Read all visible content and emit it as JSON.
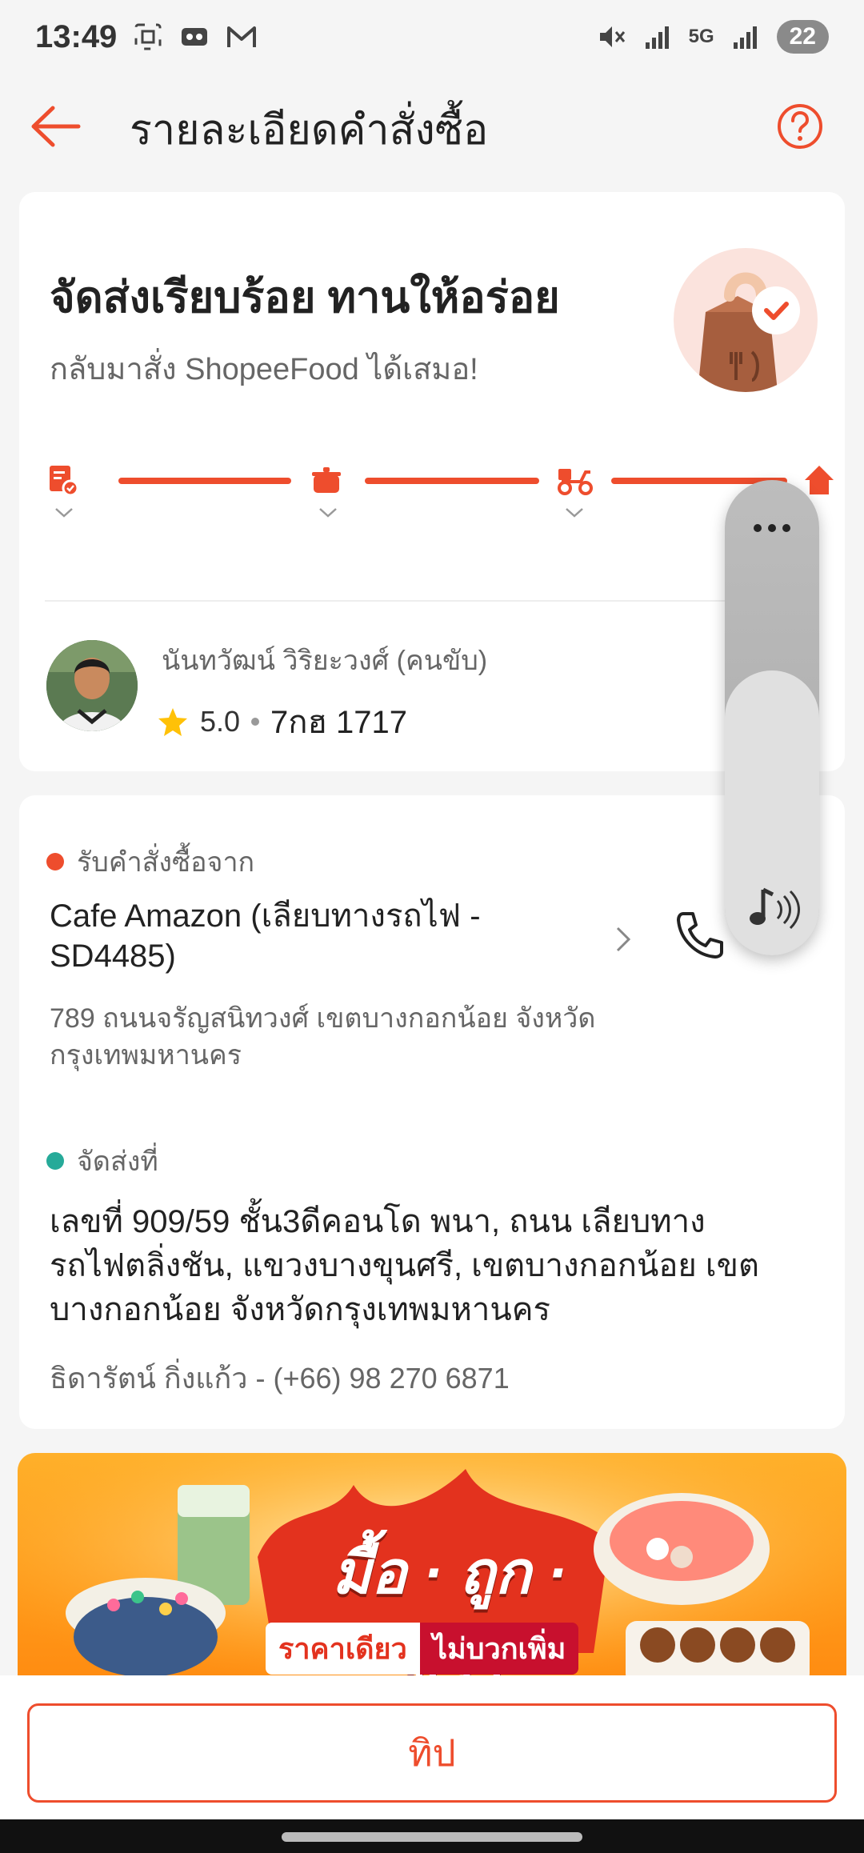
{
  "status_bar": {
    "time": "13:49",
    "network": "5G",
    "battery": "22"
  },
  "header": {
    "title": "รายละเอียดคำสั่งซื้อ"
  },
  "status_card": {
    "title": "จัดส่งเรียบร้อย ทานให้อร่อย",
    "subtitle": "กลับมาสั่ง ShopeeFood ได้เสมอ!",
    "progress_steps_completed": 4,
    "progress_steps_total": 4
  },
  "driver": {
    "name": "นันทวัฒน์ วิริยะวงศ์  (คนขับ)",
    "rating": "5.0",
    "plate": "7กฮ 1717"
  },
  "pickup": {
    "label": "รับคำสั่งซื้อจาก",
    "store_name": "Cafe Amazon (เลียบทางรถไฟ - SD4485)",
    "address": "789 ถนนจรัญสนิทวงศ์ เขตบางกอกน้อย จังหวัดกรุงเทพมหานคร"
  },
  "delivery": {
    "label": "จัดส่งที่",
    "address": "เลขที่ 909/59 ชั้น3ดีคอนโด พนา, ถนน เลียบทางรถไฟตลิ่งชัน, แขวงบางขุนศรี, เขตบางกอกน้อย เขตบางกอกน้อย จังหวัดกรุงเทพมหานคร",
    "recipient": "ธิดารัตน์ กิ่งแก้ว - (+66) 98 270 6871"
  },
  "banner": {
    "headline": "มื้อ · ถูก · ชัวร์",
    "tag_left": "ราคาเดียว",
    "tag_right": "ไม่บวกเพิ่ม"
  },
  "bottom": {
    "tip_label": "ทิป"
  },
  "colors": {
    "accent": "#ee4d2d",
    "pickup_dot": "#ee4d2d",
    "delivery_dot": "#26aa99",
    "star": "#ffc107"
  },
  "volume_overlay": {
    "level": 0.6
  }
}
